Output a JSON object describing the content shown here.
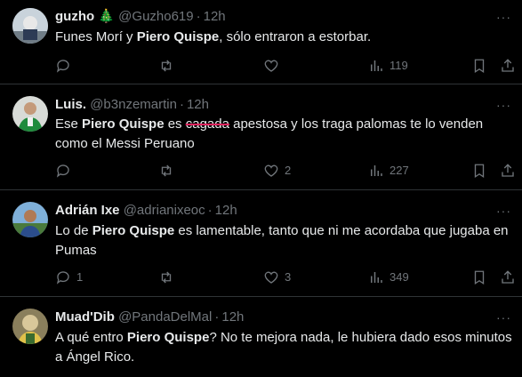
{
  "tweets": [
    {
      "name": "guzho 🎄",
      "handle": "@Guzho619",
      "time": "12h",
      "text_parts": [
        "Funes Morí y ",
        "Piero Quispe",
        ", sólo entraron a estorbar."
      ],
      "replies": "",
      "retweets": "",
      "likes": "",
      "views": "119"
    },
    {
      "name": "Luis.",
      "handle": "@b3nzemartin",
      "time": "12h",
      "text_parts": [
        "Ese ",
        "Piero Quispe",
        " es ",
        "cagada",
        " apestosa y los traga palomas te lo venden como el Messi Peruano"
      ],
      "replies": "",
      "retweets": "",
      "likes": "2",
      "views": "227"
    },
    {
      "name": "Adrián Ixe",
      "handle": "@adrianixeoc",
      "time": "12h",
      "text_parts": [
        "Lo de ",
        "Piero Quispe",
        " es lamentable, tanto que ni me acordaba que jugaba en Pumas"
      ],
      "replies": "1",
      "retweets": "",
      "likes": "3",
      "views": "349"
    },
    {
      "name": "Muad'Dib",
      "handle": "@PandaDelMal",
      "time": "12h",
      "text_parts": [
        "A qué entro ",
        "Piero Quispe",
        "? No te mejora nada, le hubiera dado esos minutos a Ángel Rico."
      ],
      "replies": "",
      "retweets": "",
      "likes": "",
      "views": ""
    }
  ],
  "more_label": "···",
  "colors": {
    "background": "#000000",
    "text": "#e7e9ea",
    "muted": "#71767b",
    "divider": "#2f3336",
    "strike": "#e0245e"
  }
}
